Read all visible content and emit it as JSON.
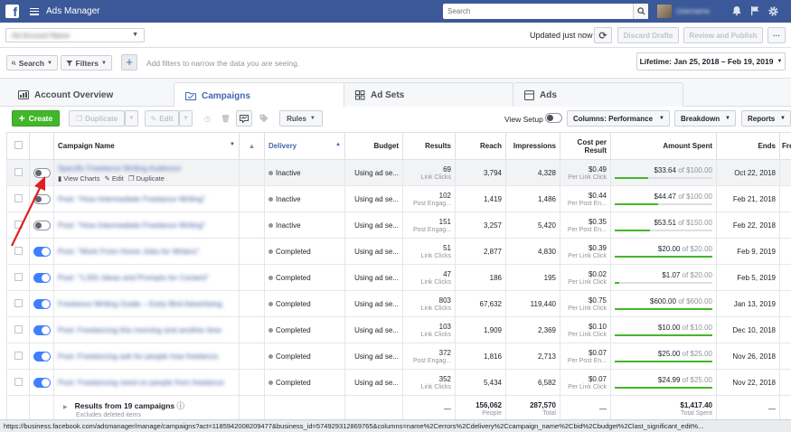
{
  "topbar": {
    "app_title": "Ads Manager",
    "search_placeholder": "Search",
    "user_name": "Username"
  },
  "header": {
    "account_name": "Ad Account Name",
    "updated_text": "Updated just now",
    "discard_label": "Discard Drafts",
    "review_label": "Review and Publish",
    "more_label": "···"
  },
  "filters": {
    "search_label": "Search",
    "filters_label": "Filters",
    "add_label": "+",
    "hint": "Add filters to narrow the data you are seeing.",
    "date_range": "Lifetime: Jan 25, 2018 – Feb 19, 2019"
  },
  "tabs": [
    {
      "label": "Account Overview"
    },
    {
      "label": "Campaigns"
    },
    {
      "label": "Ad Sets"
    },
    {
      "label": "Ads"
    }
  ],
  "toolbar": {
    "create_label": "Create",
    "duplicate_label": "Duplicate",
    "edit_label": "Edit",
    "rules_label": "Rules",
    "view_setup_label": "View Setup",
    "columns_label": "Columns: Performance",
    "breakdown_label": "Breakdown",
    "reports_label": "Reports"
  },
  "table": {
    "headers": {
      "name": "Campaign Name",
      "delivery": "Delivery",
      "budget": "Budget",
      "results": "Results",
      "reach": "Reach",
      "impressions": "Impressions",
      "cost": "Cost per Result",
      "amount": "Amount Spent",
      "ends": "Ends",
      "freq": "Fre"
    },
    "row_actions": {
      "view_charts": "View Charts",
      "edit": "Edit",
      "duplicate": "Duplicate"
    },
    "rows": [
      {
        "name": "Specific Freelance Writing Audience",
        "on": false,
        "delivery": "Inactive",
        "budget": "Using ad se...",
        "results": "69",
        "results_sub": "Link Clicks",
        "reach": "3,794",
        "impressions": "4,328",
        "cost": "$0.49",
        "cost_sub": "Per Link Click",
        "spent": "$33.64",
        "of": "of $100.00",
        "pct": 0.34,
        "ends": "Oct 22, 2018"
      },
      {
        "name": "Post: \"How Intermediate Freelance Writing\"",
        "on": false,
        "delivery": "Inactive",
        "budget": "Using ad se...",
        "results": "102",
        "results_sub": "Post Engag...",
        "reach": "1,419",
        "impressions": "1,486",
        "cost": "$0.44",
        "cost_sub": "Per Post En...",
        "spent": "$44.47",
        "of": "of $100.00",
        "pct": 0.44,
        "ends": "Feb 21, 2018"
      },
      {
        "name": "Post: \"How Intermediate Freelance Writing\"",
        "on": false,
        "delivery": "Inactive",
        "budget": "Using ad se...",
        "results": "151",
        "results_sub": "Post Engag...",
        "reach": "3,257",
        "impressions": "5,420",
        "cost": "$0.35",
        "cost_sub": "Per Post En...",
        "spent": "$53.51",
        "of": "of $150.00",
        "pct": 0.36,
        "ends": "Feb 22, 2018"
      },
      {
        "name": "Post: \"Work From Home Jobs for Writers\"",
        "on": true,
        "delivery": "Completed",
        "budget": "Using ad se...",
        "results": "51",
        "results_sub": "Link Clicks",
        "reach": "2,877",
        "impressions": "4,830",
        "cost": "$0.39",
        "cost_sub": "Per Link Click",
        "spent": "$20.00",
        "of": "of $20.00",
        "pct": 1.0,
        "ends": "Feb 9, 2019"
      },
      {
        "name": "Post: \"1,001 Ideas and Prompts for Content\"",
        "on": true,
        "delivery": "Completed",
        "budget": "Using ad se...",
        "results": "47",
        "results_sub": "Link Clicks",
        "reach": "186",
        "impressions": "195",
        "cost": "$0.02",
        "cost_sub": "Per Link Click",
        "spent": "$1.07",
        "of": "of $20.00",
        "pct": 0.05,
        "ends": "Feb 5, 2019"
      },
      {
        "name": "Freelance Writing Guide – Early Bird Advertising",
        "on": true,
        "delivery": "Completed",
        "budget": "Using ad se...",
        "results": "803",
        "results_sub": "Link Clicks",
        "reach": "67,632",
        "impressions": "119,440",
        "cost": "$0.75",
        "cost_sub": "Per Link Click",
        "spent": "$600.00",
        "of": "of $600.00",
        "pct": 1.0,
        "ends": "Jan 13, 2019"
      },
      {
        "name": "Post: Freelancing this morning and another time",
        "on": true,
        "delivery": "Completed",
        "budget": "Using ad se...",
        "results": "103",
        "results_sub": "Link Clicks",
        "reach": "1,909",
        "impressions": "2,369",
        "cost": "$0.10",
        "cost_sub": "Per Link Click",
        "spent": "$10.00",
        "of": "of $10.00",
        "pct": 1.0,
        "ends": "Dec 10, 2018"
      },
      {
        "name": "Post: Freelancing ask for people how freelance",
        "on": true,
        "delivery": "Completed",
        "budget": "Using ad se...",
        "results": "372",
        "results_sub": "Post Engag...",
        "reach": "1,816",
        "impressions": "2,713",
        "cost": "$0.07",
        "cost_sub": "Per Post En...",
        "spent": "$25.00",
        "of": "of $25.00",
        "pct": 1.0,
        "ends": "Nov 26, 2018"
      },
      {
        "name": "Post: Freelancing need on people from freelance",
        "on": true,
        "delivery": "Completed",
        "budget": "Using ad se...",
        "results": "352",
        "results_sub": "Link Clicks",
        "reach": "5,434",
        "impressions": "6,582",
        "cost": "$0.07",
        "cost_sub": "Per Link Click",
        "spent": "$24.99",
        "of": "of $25.00",
        "pct": 1.0,
        "ends": "Nov 22, 2018"
      }
    ],
    "totals": {
      "label": "Results from 19 campaigns",
      "sub": "Excludes deleted items",
      "results": "—",
      "reach": "156,062",
      "reach_sub": "People",
      "impressions": "287,570",
      "impressions_sub": "Total",
      "cost": "—",
      "spent": "$1,417.40",
      "spent_sub": "Total Spent",
      "ends": "—"
    }
  },
  "status_url": "https://business.facebook.com/adsmanager/manage/campaigns?act=1185942008209477&business_id=574929312869765&columns=name%2Cerrors%2Cdelivery%2Ccampaign_name%2Cbid%2Cbudget%2Clast_significant_edit%..."
}
